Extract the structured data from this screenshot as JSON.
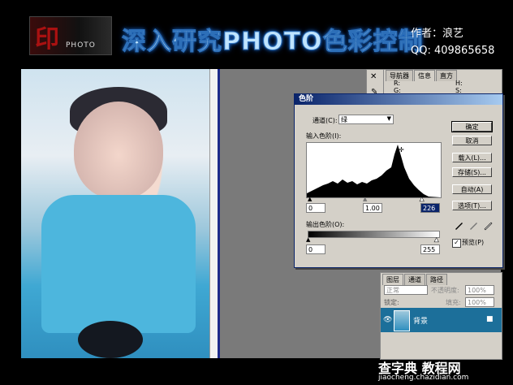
{
  "header": {
    "logo_letter": "印",
    "logo_text": "PHOTO",
    "title": "深入研究PHOTO色彩控制",
    "author": "作者：浪艺",
    "qq": "QQ:  409865658"
  },
  "info_panel": {
    "tabs": [
      "导航器",
      "信息",
      "直方"
    ],
    "r_label": "R:",
    "g_label": "G:",
    "h_label": "H:",
    "s_label": "S:"
  },
  "levels_dialog": {
    "title": "色阶",
    "channel_label": "通道(C):",
    "channel_value": "绿",
    "input_levels_label": "输入色阶(I):",
    "input_black": "0",
    "input_gamma": "1.00",
    "input_white": "226",
    "output_levels_label": "输出色阶(O):",
    "output_black": "0",
    "output_white": "255",
    "buttons": {
      "ok": "确定",
      "cancel": "取消",
      "load": "载入(L)...",
      "save": "存储(S)...",
      "auto": "自动(A)",
      "options": "选项(T)..."
    },
    "preview_label": "预览(P)",
    "preview_checked": true
  },
  "layers_panel": {
    "tabs": [
      "图层",
      "通道",
      "路径"
    ],
    "blend_mode": "正常",
    "opacity_label": "不透明度:",
    "opacity_value": "100%",
    "lock_label": "锁定:",
    "fill_label": "填充:",
    "fill_value": "100%",
    "layer_name": "背景"
  },
  "watermark": {
    "main": "查字典 教程网",
    "url": "jiaocheng.chazidian.com"
  },
  "colors": {
    "title_glow": "#1b6fd6",
    "dialog_title": "#0a246a",
    "layer_selected": "#1c6f9a",
    "workspace": "#7a7a7a"
  }
}
